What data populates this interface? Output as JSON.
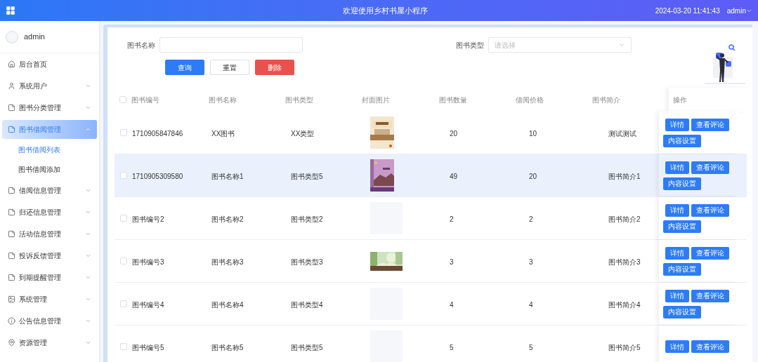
{
  "header": {
    "title": "欢迎使用乡村书屋小程序",
    "datetime": "2024-03-20 11:41:43",
    "user": "admin"
  },
  "sidebar": {
    "user": "admin",
    "items": [
      {
        "label": "后台首页",
        "selected": false
      },
      {
        "label": "系统用户",
        "expanded": false,
        "selected": false
      },
      {
        "label": "图书分类管理",
        "expanded": false,
        "selected": false
      },
      {
        "label": "图书借阅管理",
        "expanded": true,
        "selected": true,
        "children": [
          {
            "label": "图书借阅列表",
            "selected": true
          },
          {
            "label": "图书借阅添加",
            "selected": false
          }
        ]
      },
      {
        "label": "借阅信息管理",
        "expanded": false,
        "selected": false
      },
      {
        "label": "归还信息管理",
        "expanded": false,
        "selected": false
      },
      {
        "label": "活动信息管理",
        "expanded": false,
        "selected": false
      },
      {
        "label": "投诉反馈管理",
        "expanded": false,
        "selected": false
      },
      {
        "label": "到期提醒管理",
        "expanded": false,
        "selected": false
      },
      {
        "label": "系统管理",
        "expanded": false,
        "selected": false
      },
      {
        "label": "公告信息管理",
        "expanded": false,
        "selected": false
      },
      {
        "label": "资源管理",
        "expanded": false,
        "selected": false
      }
    ]
  },
  "search": {
    "fields": [
      {
        "label": "图书名称",
        "kind": "input"
      },
      {
        "label": "图书类型",
        "kind": "select",
        "placeholder": "请选择"
      }
    ],
    "buttons": [
      {
        "label": "查询",
        "kind": "primary"
      },
      {
        "label": "重置",
        "kind": "default"
      },
      {
        "label": "删除",
        "kind": "danger"
      }
    ]
  },
  "table": {
    "all_checked": false,
    "columns": [
      "图书编号",
      "图书名称",
      "图书类型",
      "封面图片",
      "图书数量",
      "借阅价格",
      "图书简介",
      "操作"
    ],
    "rows": [
      {
        "checked": false,
        "highlighted": false,
        "code": "1710905847846",
        "name": "XX图书",
        "type": "XX类型",
        "quantity": "20",
        "price": "10",
        "intro": "测试测试",
        "actions": [
          "详情",
          "查看评论",
          "内容设置"
        ]
      },
      {
        "checked": false,
        "highlighted": true,
        "code": "1710905309580",
        "name": "图书名称1",
        "type": "图书类型5",
        "quantity": "49",
        "price": "20",
        "intro": "图书简介1",
        "actions": [
          "详情",
          "查看评论",
          "内容设置"
        ]
      },
      {
        "checked": false,
        "highlighted": false,
        "code": "图书编号2",
        "name": "图书名称2",
        "type": "图书类型2",
        "cover": {
          "kind": "empty"
        },
        "quantity": "2",
        "price": "2",
        "intro": "图书简介2",
        "actions": [
          "详情",
          "查看评论",
          "内容设置"
        ]
      },
      {
        "checked": false,
        "highlighted": false,
        "code": "图书编号3",
        "name": "图书名称3",
        "type": "图书类型3",
        "quantity": "3",
        "price": "3",
        "intro": "图书简介3",
        "actions": [
          "详情",
          "查看评论",
          "内容设置"
        ]
      },
      {
        "checked": false,
        "highlighted": false,
        "code": "图书编号4",
        "name": "图书名称4",
        "type": "图书类型4",
        "cover": {
          "kind": "empty"
        },
        "quantity": "4",
        "price": "4",
        "intro": "图书简介4",
        "actions": [
          "详情",
          "查看评论",
          "内容设置"
        ]
      },
      {
        "checked": false,
        "highlighted": false,
        "code": "图书编号5",
        "name": "图书名称5",
        "type": "图书类型5",
        "cover": {
          "kind": "empty"
        },
        "quantity": "5",
        "price": "5",
        "intro": "图书简介5",
        "actions": [
          "详情",
          "查看评论"
        ]
      }
    ]
  }
}
